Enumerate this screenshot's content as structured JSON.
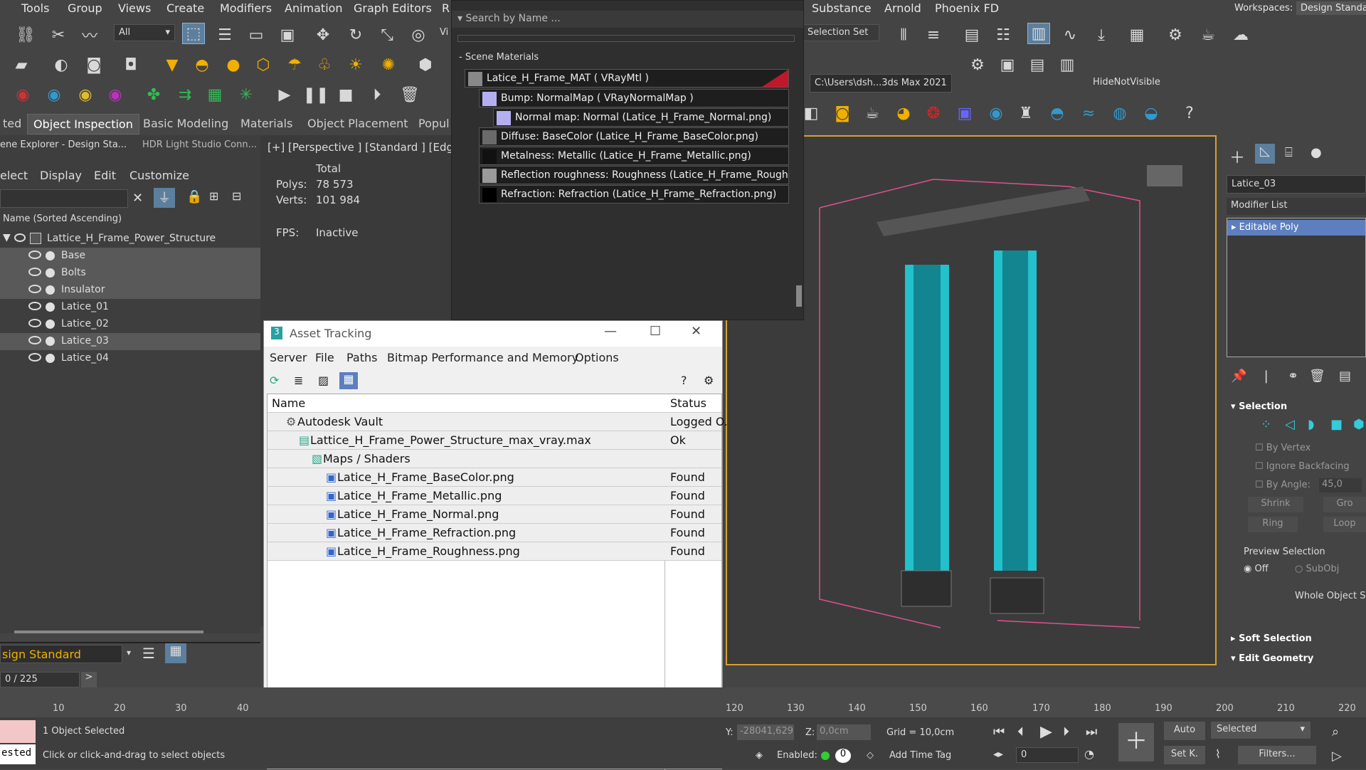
{
  "menubar": {
    "items": [
      "Tools",
      "Group",
      "Views",
      "Create",
      "Modifiers",
      "Animation",
      "Graph Editors",
      "R",
      "Substance",
      "Arnold",
      "Phoenix FD"
    ],
    "workspaces_label": "Workspaces:",
    "workspace_value": "Design Standa"
  },
  "toolbar": {
    "filter_select": "All",
    "view_select": "Vi",
    "selection_set": "Selection Set",
    "path_field": "C:\\Users\\dsh...3ds Max 2021",
    "hide_not_visible": "HideNotVisible"
  },
  "ribbon": {
    "tabs": [
      "ted",
      "Object Inspection",
      "Basic Modeling",
      "Materials",
      "Object Placement",
      "Popul"
    ]
  },
  "scene_explorer": {
    "tabs": [
      "ene Explorer - Design Sta...",
      "HDR Light Studio Conn..."
    ],
    "menu": [
      "elect",
      "Display",
      "Edit",
      "Customize"
    ],
    "sort_header": "Name (Sorted Ascending)",
    "root": "Lattice_H_Frame_Power_Structure",
    "items": [
      {
        "label": "Base",
        "highlight": true
      },
      {
        "label": "Bolts",
        "highlight": true
      },
      {
        "label": "Insulator",
        "highlight": true
      },
      {
        "label": "Latice_01",
        "highlight": false
      },
      {
        "label": "Latice_02",
        "highlight": false
      },
      {
        "label": "Latice_03",
        "highlight": true
      },
      {
        "label": "Latice_04",
        "highlight": false
      }
    ],
    "layer_label": "sign Standard",
    "frame_counter": "0 / 225"
  },
  "viewport_info": {
    "label": "[+] [Perspective ] [Standard ] [Edge",
    "total_label": "Total",
    "polys_label": "Polys:",
    "polys_value": "78 573",
    "verts_label": "Verts:",
    "verts_value": "101 984",
    "fps_label": "FPS:",
    "fps_value": "Inactive"
  },
  "material_panel": {
    "search_placeholder": "Search by Name ...",
    "section": "Scene Materials",
    "rows": [
      "Latice_H_Frame_MAT  ( VRayMtl )",
      "Bump: NormalMap  ( VRayNormalMap )",
      "Normal map: Normal (Latice_H_Frame_Normal.png)",
      "Diffuse: BaseColor (Latice_H_Frame_BaseColor.png)",
      "Metalness: Metallic (Latice_H_Frame_Metallic.png)",
      "Reflection  roughness:  Roughness  (Latice_H_Frame_Roughn...",
      "Refraction: Refraction (Latice_H_Frame_Refraction.png)"
    ]
  },
  "asset_tracking": {
    "title": "Asset Tracking",
    "menu": [
      "Server",
      "File",
      "Paths",
      "Bitmap Performance and Memory",
      "Options"
    ],
    "col_name": "Name",
    "col_status": "Status",
    "rows": [
      {
        "name": "Autodesk Vault",
        "status": "Logged O."
      },
      {
        "name": "Lattice_H_Frame_Power_Structure_max_vray.max",
        "status": "Ok"
      },
      {
        "name": "Maps / Shaders",
        "status": ""
      },
      {
        "name": "Latice_H_Frame_BaseColor.png",
        "status": "Found"
      },
      {
        "name": "Latice_H_Frame_Metallic.png",
        "status": "Found"
      },
      {
        "name": "Latice_H_Frame_Normal.png",
        "status": "Found"
      },
      {
        "name": "Latice_H_Frame_Refraction.png",
        "status": "Found"
      },
      {
        "name": "Latice_H_Frame_Roughness.png",
        "status": "Found"
      }
    ]
  },
  "command_panel": {
    "object_name": "Latice_03",
    "modifier_list": "Modifier List",
    "modifier": "Editable Poly",
    "selection_title": "Selection",
    "by_vertex": "By Vertex",
    "ignore_backfacing": "Ignore Backfacing",
    "by_angle": "By Angle:",
    "angle_value": "45,0",
    "shrink": "Shrink",
    "grow": "Gro",
    "ring": "Ring",
    "loop": "Loop",
    "preview_selection": "Preview Selection",
    "off": "Off",
    "subobj": "SubObj",
    "whole_object": "Whole Object Se",
    "soft_selection": "Soft Selection",
    "edit_geometry": "Edit Geometry"
  },
  "timeline": {
    "ticks_left": [
      "10",
      "20",
      "30",
      "40"
    ],
    "ticks_right": [
      "120",
      "130",
      "140",
      "150",
      "160",
      "170",
      "180",
      "190",
      "200",
      "210",
      "220"
    ]
  },
  "status": {
    "selected_text": "1 Object Selected",
    "prompt": "Click or click-and-drag to select objects",
    "script_label": "ested",
    "y_label": "Y:",
    "y_value": "-28041,629",
    "z_label": "Z:",
    "z_value": "0,0cm",
    "grid": "Grid = 10,0cm",
    "enabled": "Enabled:",
    "add_time_tag": "Add Time Tag",
    "auto": "Auto",
    "set_key": "Set K.",
    "selected_dropdown": "Selected",
    "filters": "Filters...",
    "frame_value": "0"
  }
}
